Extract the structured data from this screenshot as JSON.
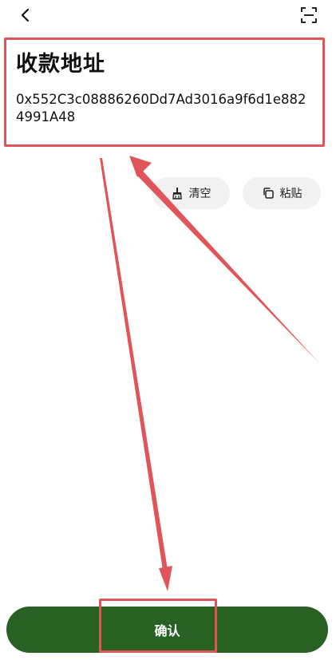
{
  "header": {
    "back_icon": "chevron-left-icon",
    "scan_icon": "scan-frame-icon"
  },
  "address": {
    "title": "收款地址",
    "value": "0x552C3c08886260Dd7Ad3016a9f6d1e8824991A48"
  },
  "actions": {
    "clear_label": "清空",
    "clear_icon": "broom-icon",
    "paste_label": "粘贴",
    "paste_icon": "copy-icon"
  },
  "footer": {
    "confirm_label": "确认"
  },
  "colors": {
    "annotation": "#e0555a",
    "confirm_bg": "#286123",
    "pill_bg": "#f2f2f2"
  }
}
